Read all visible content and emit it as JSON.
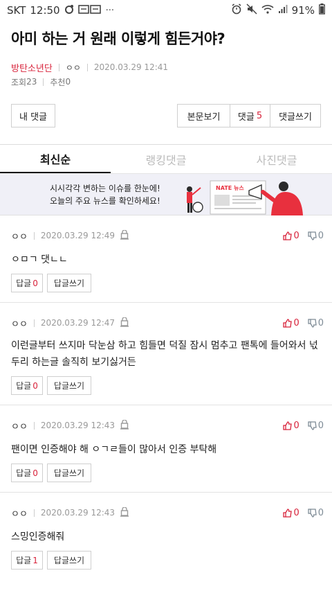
{
  "status": {
    "carrier": "SKT",
    "time": "12:50",
    "battery": "91%"
  },
  "post": {
    "title": "아미 하는 거 원래 이렇게 힘든거야?",
    "author": "방탄소년단",
    "nickname": "ㅇㅇ",
    "date": "2020.03.29 12:41",
    "views_label": "조회",
    "views": "23",
    "recommend_label": "추천",
    "recommend": "0"
  },
  "buttons": {
    "my_comments": "내 댓글",
    "view_body": "본문보기",
    "comments_label": "댓글",
    "comments_count": "5",
    "write_comment": "댓글쓰기"
  },
  "tabs": [
    {
      "label": "최신순"
    },
    {
      "label": "랭킹댓글"
    },
    {
      "label": "사진댓글"
    }
  ],
  "banner": {
    "line1": "시시각각 변하는 이슈를 한눈에!",
    "line2": "오늘의 주요 뉴스를 확인하세요!",
    "logo_text": "NATE 뉴스",
    "accent": "#e8303e"
  },
  "comments": [
    {
      "author": "ㅇㅇ",
      "date": "2020.03.29 12:49",
      "up": "0",
      "down": "0",
      "body": "ㅇㅁㄱ 댓ㄴㄴ",
      "reply_label": "답글",
      "reply_count": "0",
      "write_label": "답글쓰기"
    },
    {
      "author": "ㅇㅇ",
      "date": "2020.03.29 12:47",
      "up": "0",
      "down": "0",
      "body": "이런글부터 쓰지마 닥눈삼 하고 힘들면 덕질 잠시 멈추고 팬톡에 들어와서 넋두리 하는글 솔직히 보기싫거든",
      "reply_label": "답글",
      "reply_count": "0",
      "write_label": "답글쓰기"
    },
    {
      "author": "ㅇㅇ",
      "date": "2020.03.29 12:43",
      "up": "0",
      "down": "0",
      "body": "팬이면 인증해야 해 ㅇㄱㄹ들이 많아서 인증 부탁해",
      "reply_label": "답글",
      "reply_count": "0",
      "write_label": "답글쓰기"
    },
    {
      "author": "ㅇㅇ",
      "date": "2020.03.29 12:43",
      "up": "0",
      "down": "0",
      "body": "스밍인증해줘",
      "reply_label": "답글",
      "reply_count": "1",
      "write_label": "답글쓰기"
    }
  ]
}
